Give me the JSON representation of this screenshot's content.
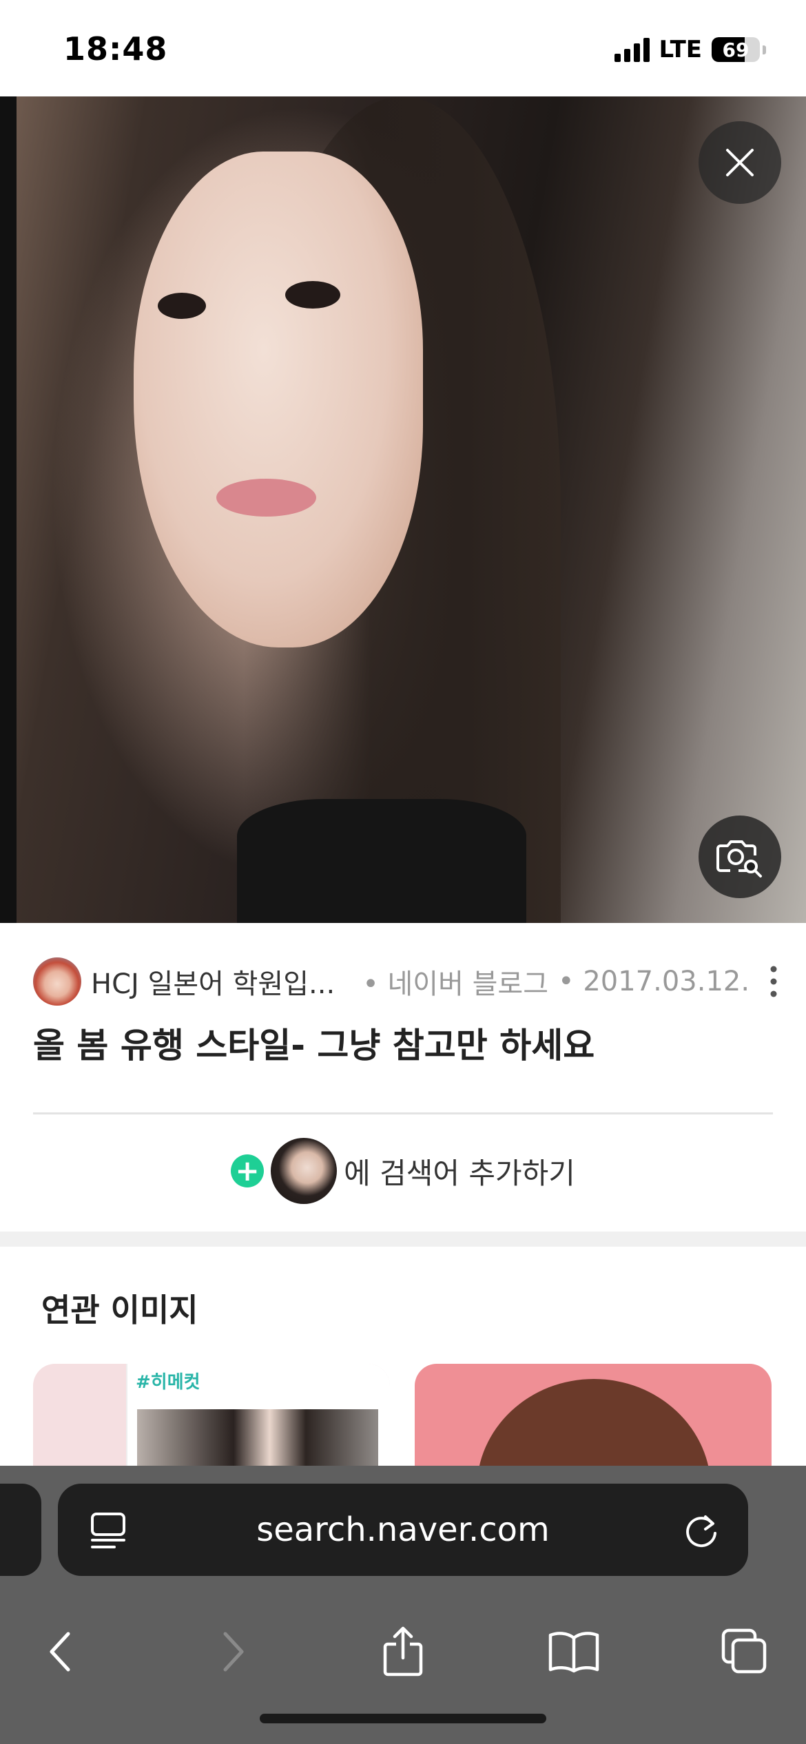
{
  "status_bar": {
    "time": "18:48",
    "network": "LTE",
    "battery": "69",
    "battery_level": 0.69
  },
  "viewer": {
    "close_icon": "close-icon",
    "lens_icon": "image-search-icon"
  },
  "result": {
    "source_name": "HCJ 일본어 학원입...",
    "source_site": "• 네이버 블로그",
    "source_date": "• 2017.03.12.",
    "title": "올 봄 유행 스타일- 그냥 참고만 하세요",
    "more_icon": "more-vertical-icon"
  },
  "add_search": {
    "plus": "+",
    "text": "에 검색어 추가하기"
  },
  "related": {
    "section_title": "연관 이미지",
    "cards": [
      {
        "tag": "#히메컷"
      }
    ]
  },
  "browser": {
    "url": "search.naver.com",
    "reader_icon": "reader-icon",
    "reload_icon": "reload-icon"
  },
  "toolbar": {
    "back_icon": "chevron-left-icon",
    "forward_icon": "chevron-right-icon",
    "share_icon": "share-icon",
    "bookmarks_icon": "book-icon",
    "tabs_icon": "tabs-icon"
  },
  "colors": {
    "accent_green": "#1ecf95",
    "tag_teal": "#29b5a8",
    "browser_bar": "#5f5f5f",
    "pill": "#1f1f1f"
  }
}
